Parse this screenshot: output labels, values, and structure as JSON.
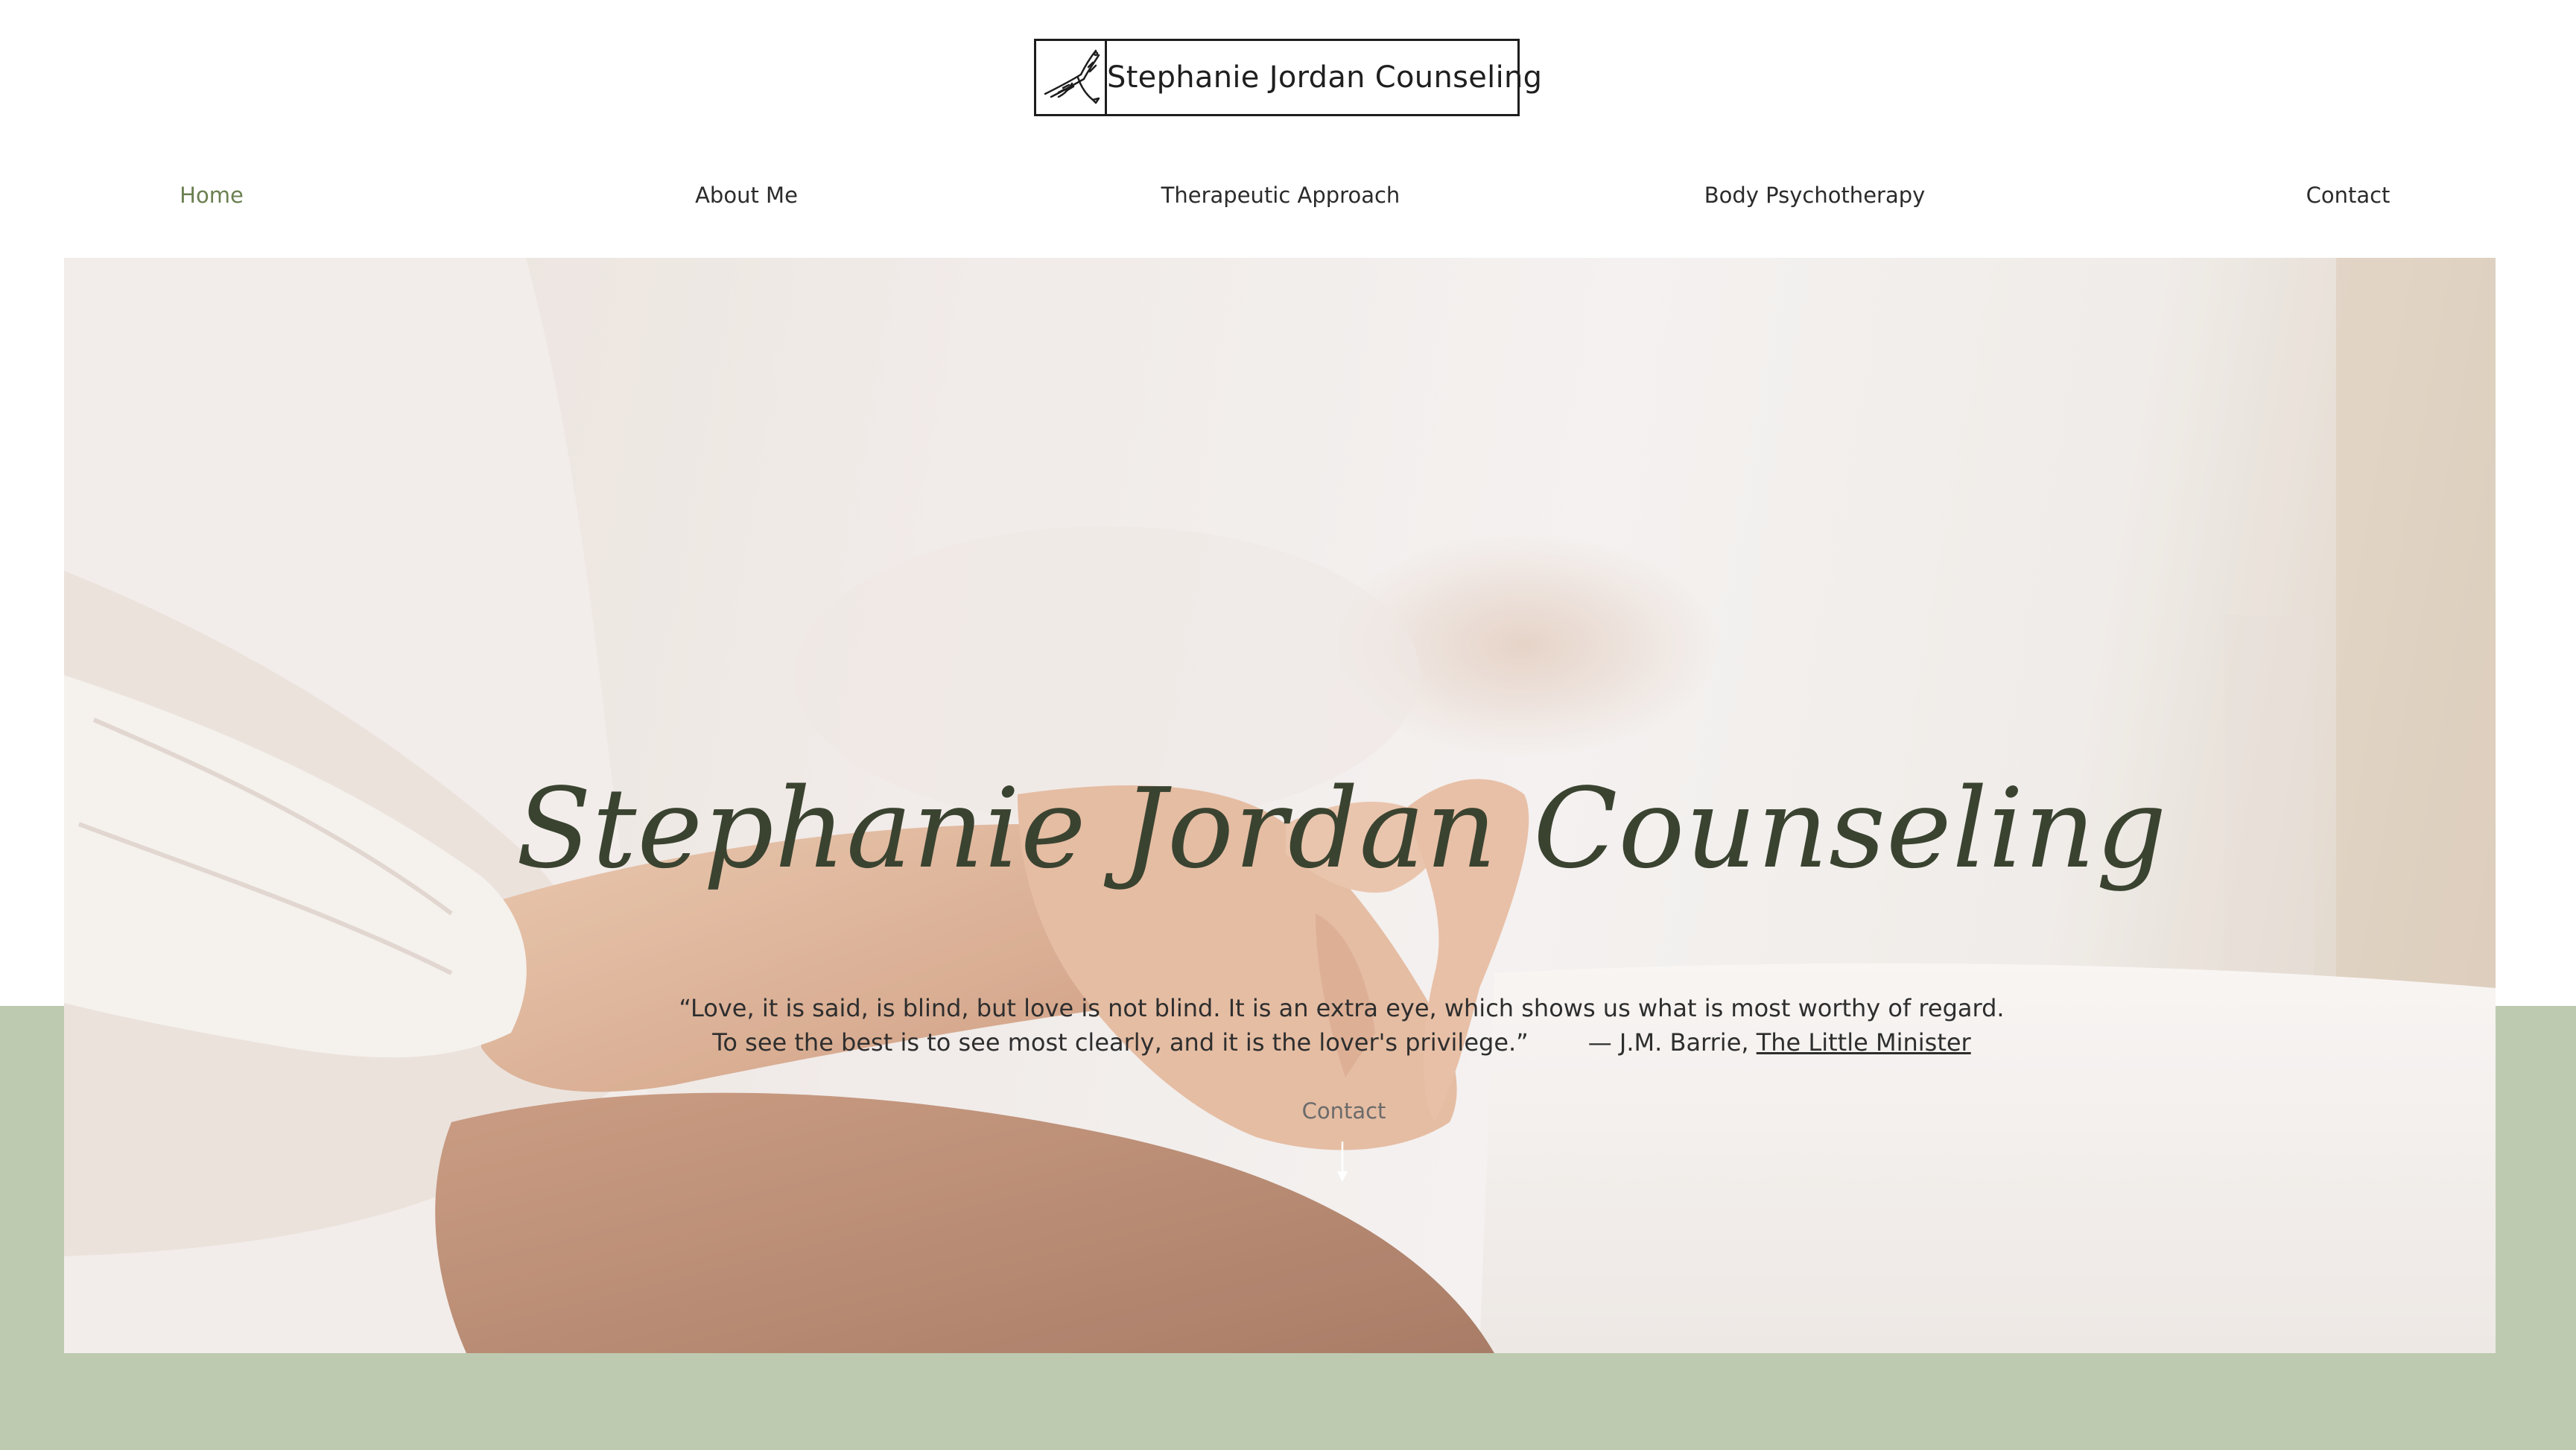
{
  "site": {
    "logo_text": "Stephanie Jordan Counseling",
    "logo_icon": "eagle-icon"
  },
  "nav": {
    "items": [
      {
        "label": "Home",
        "active": true
      },
      {
        "label": "About Me",
        "active": false
      },
      {
        "label": "Therapeutic Approach",
        "active": false
      },
      {
        "label": "Body Psychotherapy",
        "active": false
      },
      {
        "label": "Contact",
        "active": false
      }
    ]
  },
  "hero": {
    "title": "Stephanie Jordan Counseling",
    "quote_line1": "“Love, it is said, is blind, but love is not blind.  It is an extra eye, which shows us what is most worthy of regard.",
    "quote_line2": "To see the best is to see most clearly, and it is the lover's privilege.”",
    "attribution": "— J.M. Barrie, ",
    "book_title": "The Little Minister",
    "cta_label": "Contact",
    "cta_icon": "arrow-down-icon"
  },
  "colors": {
    "accent_green": "#bdcaaf",
    "title_color": "#3a4330",
    "active_nav": "#6a7f50"
  }
}
